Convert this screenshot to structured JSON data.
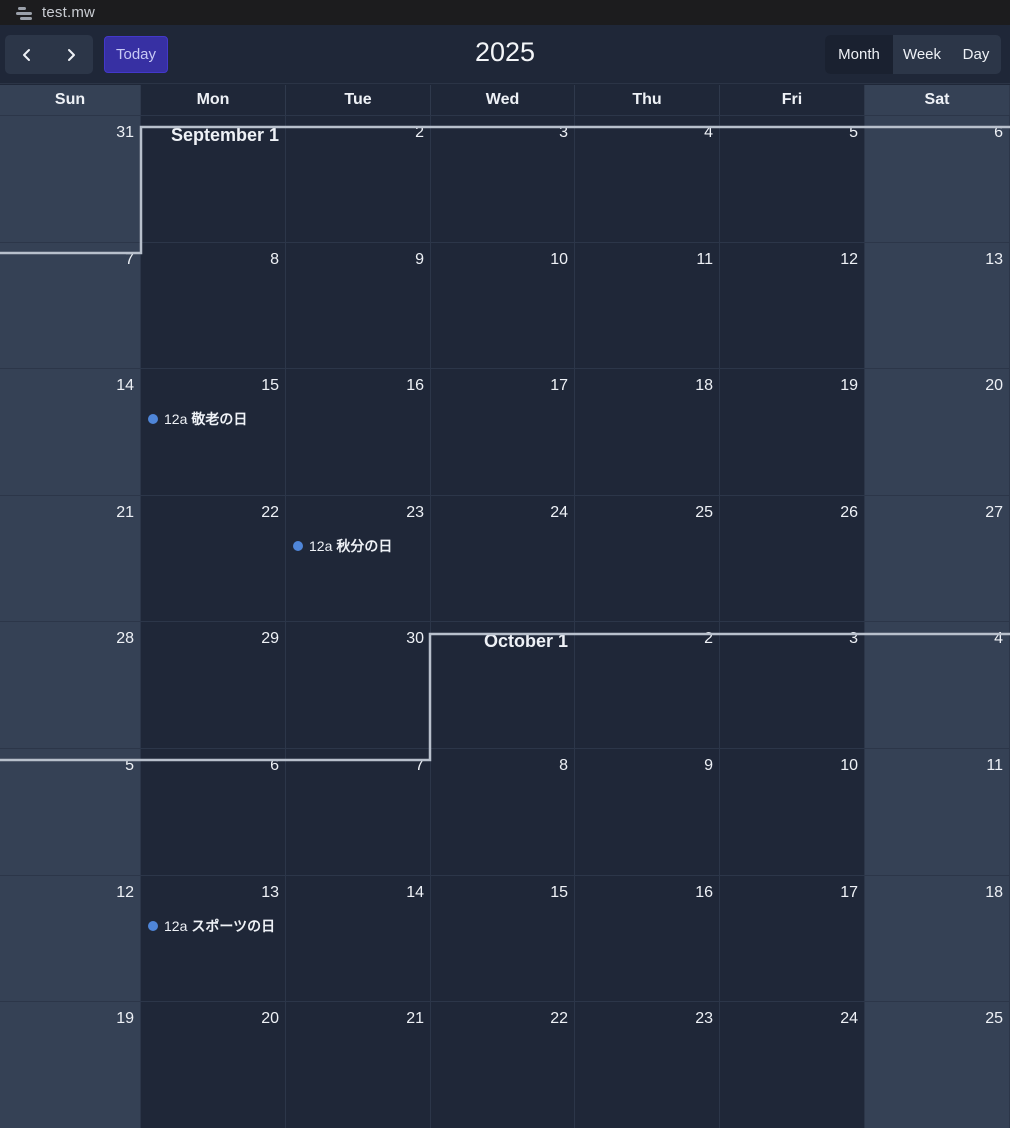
{
  "window": {
    "title": "test.mw"
  },
  "toolbar": {
    "prev_icon": "chevron-left-icon",
    "next_icon": "chevron-right-icon",
    "today_label": "Today",
    "heading": "2025",
    "views": [
      "Month",
      "Week",
      "Day"
    ],
    "active_view": "Month"
  },
  "colors": {
    "background": "#1f2738",
    "weekend": "#354155",
    "today_button": "#3730a3",
    "event_dot": "#4f86d9",
    "month_boundary": "#b8c0cc"
  },
  "weekdays": [
    "Sun",
    "Mon",
    "Tue",
    "Wed",
    "Thu",
    "Fri",
    "Sat"
  ],
  "weeks": [
    [
      "31",
      "September 1",
      "2",
      "3",
      "4",
      "5",
      "6"
    ],
    [
      "7",
      "8",
      "9",
      "10",
      "11",
      "12",
      "13"
    ],
    [
      "14",
      "15",
      "16",
      "17",
      "18",
      "19",
      "20"
    ],
    [
      "21",
      "22",
      "23",
      "24",
      "25",
      "26",
      "27"
    ],
    [
      "28",
      "29",
      "30",
      "October 1",
      "2",
      "3",
      "4"
    ],
    [
      "5",
      "6",
      "7",
      "8",
      "9",
      "10",
      "11"
    ],
    [
      "12",
      "13",
      "14",
      "15",
      "16",
      "17",
      "18"
    ],
    [
      "19",
      "20",
      "21",
      "22",
      "23",
      "24",
      "25"
    ]
  ],
  "events": [
    {
      "week": 2,
      "day": 1,
      "time": "12a",
      "title": "敬老の日"
    },
    {
      "week": 3,
      "day": 2,
      "time": "12a",
      "title": "秋分の日"
    },
    {
      "week": 6,
      "day": 1,
      "time": "12a",
      "title": "スポーツの日"
    }
  ]
}
